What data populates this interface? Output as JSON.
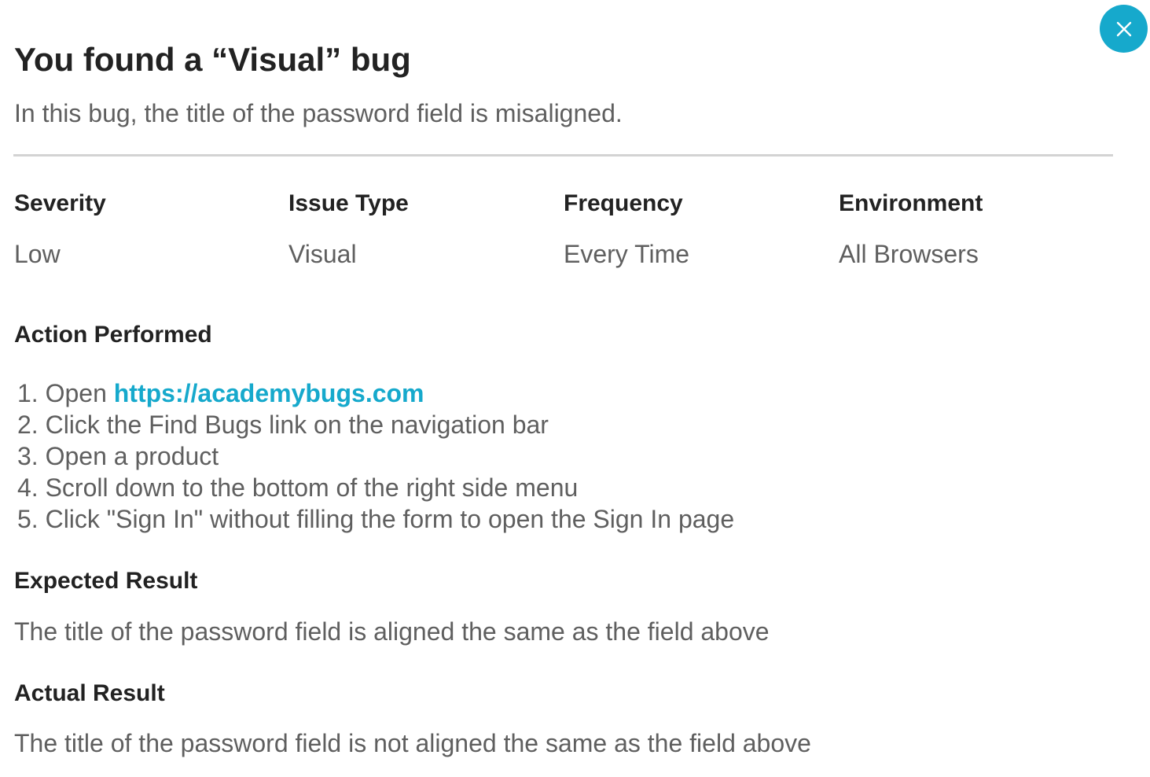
{
  "modal": {
    "close_label": "close",
    "accent_color": "#16a9cc",
    "title": "You found a “Visual” bug",
    "subtitle": "In this bug, the title of the password field is misaligned."
  },
  "meta": [
    {
      "label": "Severity",
      "value": "Low"
    },
    {
      "label": "Issue Type",
      "value": "Visual"
    },
    {
      "label": "Frequency",
      "value": "Every Time"
    },
    {
      "label": "Environment",
      "value": "All Browsers"
    }
  ],
  "action": {
    "heading": "Action Performed",
    "steps": [
      {
        "number": "1.",
        "prefix": "Open ",
        "link": "https://academybugs.com"
      },
      {
        "number": "2.",
        "text": "Click the Find Bugs link on the navigation bar"
      },
      {
        "number": "3.",
        "text": "Open a product"
      },
      {
        "number": "4.",
        "text": "Scroll down to the bottom of the right side menu"
      },
      {
        "number": "5.",
        "text": "Click \"Sign In\" without filling the form to open the Sign In page"
      }
    ]
  },
  "expected": {
    "heading": "Expected Result",
    "text": "The title of the password field is aligned the same as the field above"
  },
  "actual": {
    "heading": "Actual Result",
    "text": "The title of the password field is not aligned the same as the field above"
  }
}
